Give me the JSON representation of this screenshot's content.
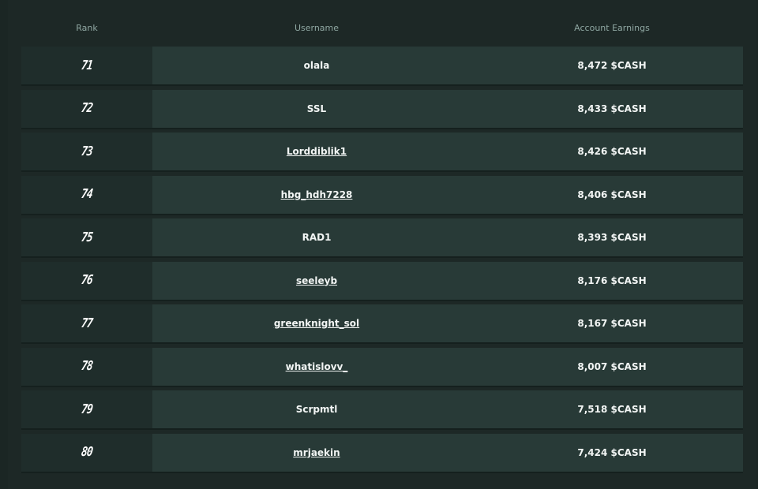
{
  "table": {
    "headers": {
      "rank": "Rank",
      "username": "Username",
      "earnings": "Account Earnings"
    },
    "rows": [
      {
        "rank": "71",
        "username": "olala",
        "earnings": "8,472 $CASH",
        "linked": false
      },
      {
        "rank": "72",
        "username": "SSL",
        "earnings": "8,433 $CASH",
        "linked": false
      },
      {
        "rank": "73",
        "username": "Lorddiblik1",
        "earnings": "8,426 $CASH",
        "linked": true
      },
      {
        "rank": "74",
        "username": "hbg_hdh7228",
        "earnings": "8,406 $CASH",
        "linked": true
      },
      {
        "rank": "75",
        "username": "RAD1",
        "earnings": "8,393 $CASH",
        "linked": false
      },
      {
        "rank": "76",
        "username": "seeleyb",
        "earnings": "8,176 $CASH",
        "linked": true
      },
      {
        "rank": "77",
        "username": "greenknight_sol",
        "earnings": "8,167 $CASH",
        "linked": true
      },
      {
        "rank": "78",
        "username": "whatislovv_",
        "earnings": "8,007 $CASH",
        "linked": true
      },
      {
        "rank": "79",
        "username": "Scrpmtl",
        "earnings": "7,518 $CASH",
        "linked": false
      },
      {
        "rank": "80",
        "username": "mrjaekin",
        "earnings": "7,424 $CASH",
        "linked": true
      }
    ]
  }
}
